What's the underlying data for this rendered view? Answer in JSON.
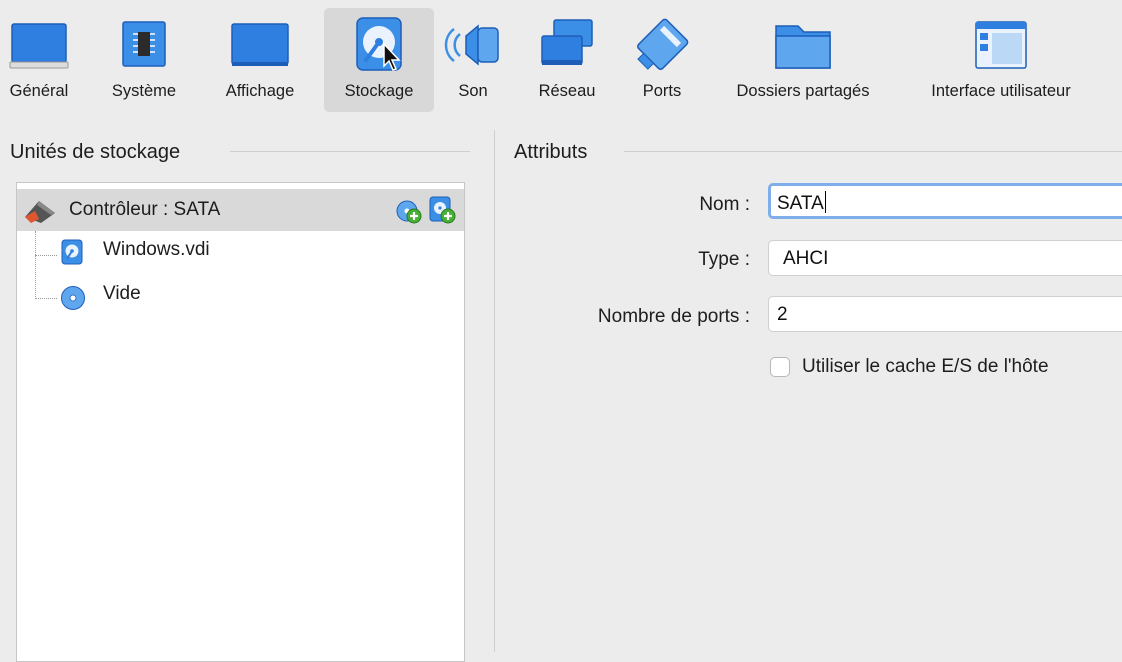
{
  "toolbar": {
    "items": [
      {
        "label": "Général",
        "icon": "general-screen-icon"
      },
      {
        "label": "Système",
        "icon": "chip-icon"
      },
      {
        "label": "Affichage",
        "icon": "monitor-icon"
      },
      {
        "label": "Stockage",
        "icon": "hard-disk-icon",
        "selected": true
      },
      {
        "label": "Son",
        "icon": "speaker-icon"
      },
      {
        "label": "Réseau",
        "icon": "network-icon"
      },
      {
        "label": "Ports",
        "icon": "serial-port-icon"
      },
      {
        "label": "Dossiers partagés",
        "icon": "folder-icon"
      },
      {
        "label": "Interface utilisateur",
        "icon": "window-icon"
      }
    ]
  },
  "storage": {
    "title": "Unités de stockage",
    "controller": {
      "label": "Contrôleur : SATA"
    },
    "items": [
      {
        "label": "Windows.vdi",
        "icon": "hard-disk-icon"
      },
      {
        "label": "Vide",
        "icon": "optical-disc-icon"
      }
    ]
  },
  "attributes": {
    "title": "Attributs",
    "name_label": "Nom :",
    "name_value": "SATA",
    "type_label": "Type :",
    "type_value": "AHCI",
    "ports_label": "Nombre de ports :",
    "ports_value": "2",
    "cache_label": "Utiliser le cache E/S de l'hôte",
    "cache_checked": false
  },
  "colors": {
    "accent_blue": "#3a8ee6",
    "selection_gray": "#d9d9d9",
    "focus_ring": "#7faeea"
  }
}
